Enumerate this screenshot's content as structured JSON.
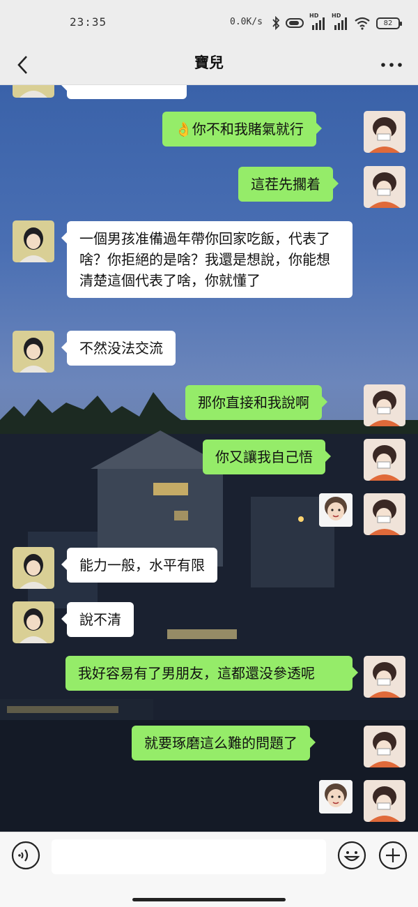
{
  "status_bar": {
    "time": "23:35",
    "network_speed": "0.0K/s",
    "signal_1_label": "HD",
    "signal_2_label": "HD",
    "battery": "82"
  },
  "header": {
    "title": "寶兒",
    "back_icon": "chevron-left-icon",
    "more_icon": "more-horizontal-icon"
  },
  "messages": [
    {
      "side": "out",
      "text": "👌你不和我賭氣就行"
    },
    {
      "side": "out",
      "text": "這茬先擱着"
    },
    {
      "side": "in",
      "text": "一個男孩准備過年帶你回家吃飯，代表了啥？你拒絕的是啥？我還是想說，你能想清楚這個代表了啥，你就懂了"
    },
    {
      "side": "in",
      "text": "不然没法交流"
    },
    {
      "side": "out",
      "text": "那你直接和我說啊"
    },
    {
      "side": "out",
      "text": "你又讓我自己悟"
    },
    {
      "side": "out",
      "type": "sticker"
    },
    {
      "side": "in",
      "text": "能力一般，水平有限"
    },
    {
      "side": "in",
      "text": "說不清"
    },
    {
      "side": "out",
      "text": "我好容易有了男朋友，這都還没參透呢"
    },
    {
      "side": "out",
      "text": "就要琢磨這么難的問題了"
    },
    {
      "side": "out",
      "type": "sticker"
    }
  ],
  "input_bar": {
    "voice_icon": "voice-icon",
    "emoji_icon": "emoji-icon",
    "plus_icon": "plus-icon"
  },
  "colors": {
    "outgoing_bubble": "#95ec69",
    "incoming_bubble": "#ffffff",
    "header_bg": "#ededed"
  }
}
